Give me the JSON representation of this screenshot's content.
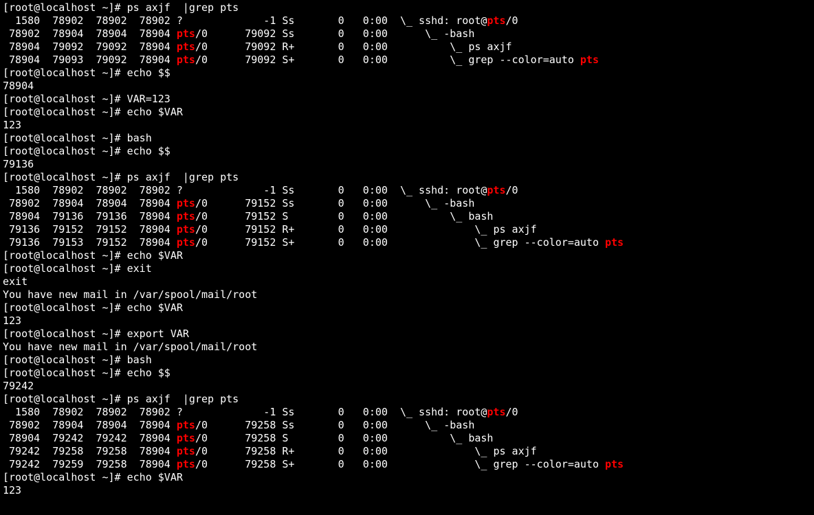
{
  "prompt": "[root@localhost ~]# ",
  "hl": "pts",
  "session": [
    {
      "type": "cmd",
      "text": "ps axjf  |grep pts"
    },
    {
      "type": "ps",
      "rows": [
        {
          "ppid": "1580",
          "pid": "78902",
          "pgid": "78902",
          "sid": "78902",
          "tty": "?",
          "tpgid": "-1",
          "stat": "Ss",
          "uid": "0",
          "time": "0:00",
          "indent": " \\_ ",
          "cmd": "sshd: root@",
          "cmd_hl": "pts",
          "cmd_tail": "/0"
        },
        {
          "ppid": "78902",
          "pid": "78904",
          "pgid": "78904",
          "sid": "78904",
          "tty": "pts/0",
          "tpgid": "79092",
          "stat": "Ss",
          "uid": "0",
          "time": "0:00",
          "indent": "     \\_ ",
          "cmd": "-bash"
        },
        {
          "ppid": "78904",
          "pid": "79092",
          "pgid": "79092",
          "sid": "78904",
          "tty": "pts/0",
          "tpgid": "79092",
          "stat": "R+",
          "uid": "0",
          "time": "0:00",
          "indent": "         \\_ ",
          "cmd": "ps axjf"
        },
        {
          "ppid": "78904",
          "pid": "79093",
          "pgid": "79092",
          "sid": "78904",
          "tty": "pts/0",
          "tpgid": "79092",
          "stat": "S+",
          "uid": "0",
          "time": "0:00",
          "indent": "         \\_ ",
          "cmd": "grep --color=auto ",
          "cmd_hl": "pts"
        }
      ]
    },
    {
      "type": "cmd",
      "text": "echo $$"
    },
    {
      "type": "out",
      "text": "78904"
    },
    {
      "type": "cmd",
      "text": "VAR=123"
    },
    {
      "type": "cmd",
      "text": "echo $VAR"
    },
    {
      "type": "out",
      "text": "123"
    },
    {
      "type": "cmd",
      "text": "bash"
    },
    {
      "type": "cmd",
      "text": "echo $$"
    },
    {
      "type": "out",
      "text": "79136"
    },
    {
      "type": "cmd",
      "text": "ps axjf  |grep pts"
    },
    {
      "type": "ps",
      "rows": [
        {
          "ppid": "1580",
          "pid": "78902",
          "pgid": "78902",
          "sid": "78902",
          "tty": "?",
          "tpgid": "-1",
          "stat": "Ss",
          "uid": "0",
          "time": "0:00",
          "indent": " \\_ ",
          "cmd": "sshd: root@",
          "cmd_hl": "pts",
          "cmd_tail": "/0"
        },
        {
          "ppid": "78902",
          "pid": "78904",
          "pgid": "78904",
          "sid": "78904",
          "tty": "pts/0",
          "tpgid": "79152",
          "stat": "Ss",
          "uid": "0",
          "time": "0:00",
          "indent": "     \\_ ",
          "cmd": "-bash"
        },
        {
          "ppid": "78904",
          "pid": "79136",
          "pgid": "79136",
          "sid": "78904",
          "tty": "pts/0",
          "tpgid": "79152",
          "stat": "S",
          "uid": "0",
          "time": "0:00",
          "indent": "         \\_ ",
          "cmd": "bash"
        },
        {
          "ppid": "79136",
          "pid": "79152",
          "pgid": "79152",
          "sid": "78904",
          "tty": "pts/0",
          "tpgid": "79152",
          "stat": "R+",
          "uid": "0",
          "time": "0:00",
          "indent": "             \\_ ",
          "cmd": "ps axjf"
        },
        {
          "ppid": "79136",
          "pid": "79153",
          "pgid": "79152",
          "sid": "78904",
          "tty": "pts/0",
          "tpgid": "79152",
          "stat": "S+",
          "uid": "0",
          "time": "0:00",
          "indent": "             \\_ ",
          "cmd": "grep --color=auto ",
          "cmd_hl": "pts"
        }
      ]
    },
    {
      "type": "cmd",
      "text": "echo $VAR"
    },
    {
      "type": "out",
      "text": ""
    },
    {
      "type": "cmd",
      "text": "exit"
    },
    {
      "type": "out",
      "text": "exit"
    },
    {
      "type": "out",
      "text": "You have new mail in /var/spool/mail/root"
    },
    {
      "type": "cmd",
      "text": "echo $VAR"
    },
    {
      "type": "out",
      "text": "123"
    },
    {
      "type": "cmd",
      "text": "export VAR"
    },
    {
      "type": "out",
      "text": "You have new mail in /var/spool/mail/root"
    },
    {
      "type": "cmd",
      "text": "bash"
    },
    {
      "type": "cmd",
      "text": "echo $$"
    },
    {
      "type": "out",
      "text": "79242"
    },
    {
      "type": "cmd",
      "text": "ps axjf  |grep pts"
    },
    {
      "type": "ps",
      "rows": [
        {
          "ppid": "1580",
          "pid": "78902",
          "pgid": "78902",
          "sid": "78902",
          "tty": "?",
          "tpgid": "-1",
          "stat": "Ss",
          "uid": "0",
          "time": "0:00",
          "indent": " \\_ ",
          "cmd": "sshd: root@",
          "cmd_hl": "pts",
          "cmd_tail": "/0"
        },
        {
          "ppid": "78902",
          "pid": "78904",
          "pgid": "78904",
          "sid": "78904",
          "tty": "pts/0",
          "tpgid": "79258",
          "stat": "Ss",
          "uid": "0",
          "time": "0:00",
          "indent": "     \\_ ",
          "cmd": "-bash"
        },
        {
          "ppid": "78904",
          "pid": "79242",
          "pgid": "79242",
          "sid": "78904",
          "tty": "pts/0",
          "tpgid": "79258",
          "stat": "S",
          "uid": "0",
          "time": "0:00",
          "indent": "         \\_ ",
          "cmd": "bash"
        },
        {
          "ppid": "79242",
          "pid": "79258",
          "pgid": "79258",
          "sid": "78904",
          "tty": "pts/0",
          "tpgid": "79258",
          "stat": "R+",
          "uid": "0",
          "time": "0:00",
          "indent": "             \\_ ",
          "cmd": "ps axjf"
        },
        {
          "ppid": "79242",
          "pid": "79259",
          "pgid": "79258",
          "sid": "78904",
          "tty": "pts/0",
          "tpgid": "79258",
          "stat": "S+",
          "uid": "0",
          "time": "0:00",
          "indent": "             \\_ ",
          "cmd": "grep --color=auto ",
          "cmd_hl": "pts"
        }
      ]
    },
    {
      "type": "cmd",
      "text": "echo $VAR"
    },
    {
      "type": "out",
      "text": "123"
    }
  ]
}
